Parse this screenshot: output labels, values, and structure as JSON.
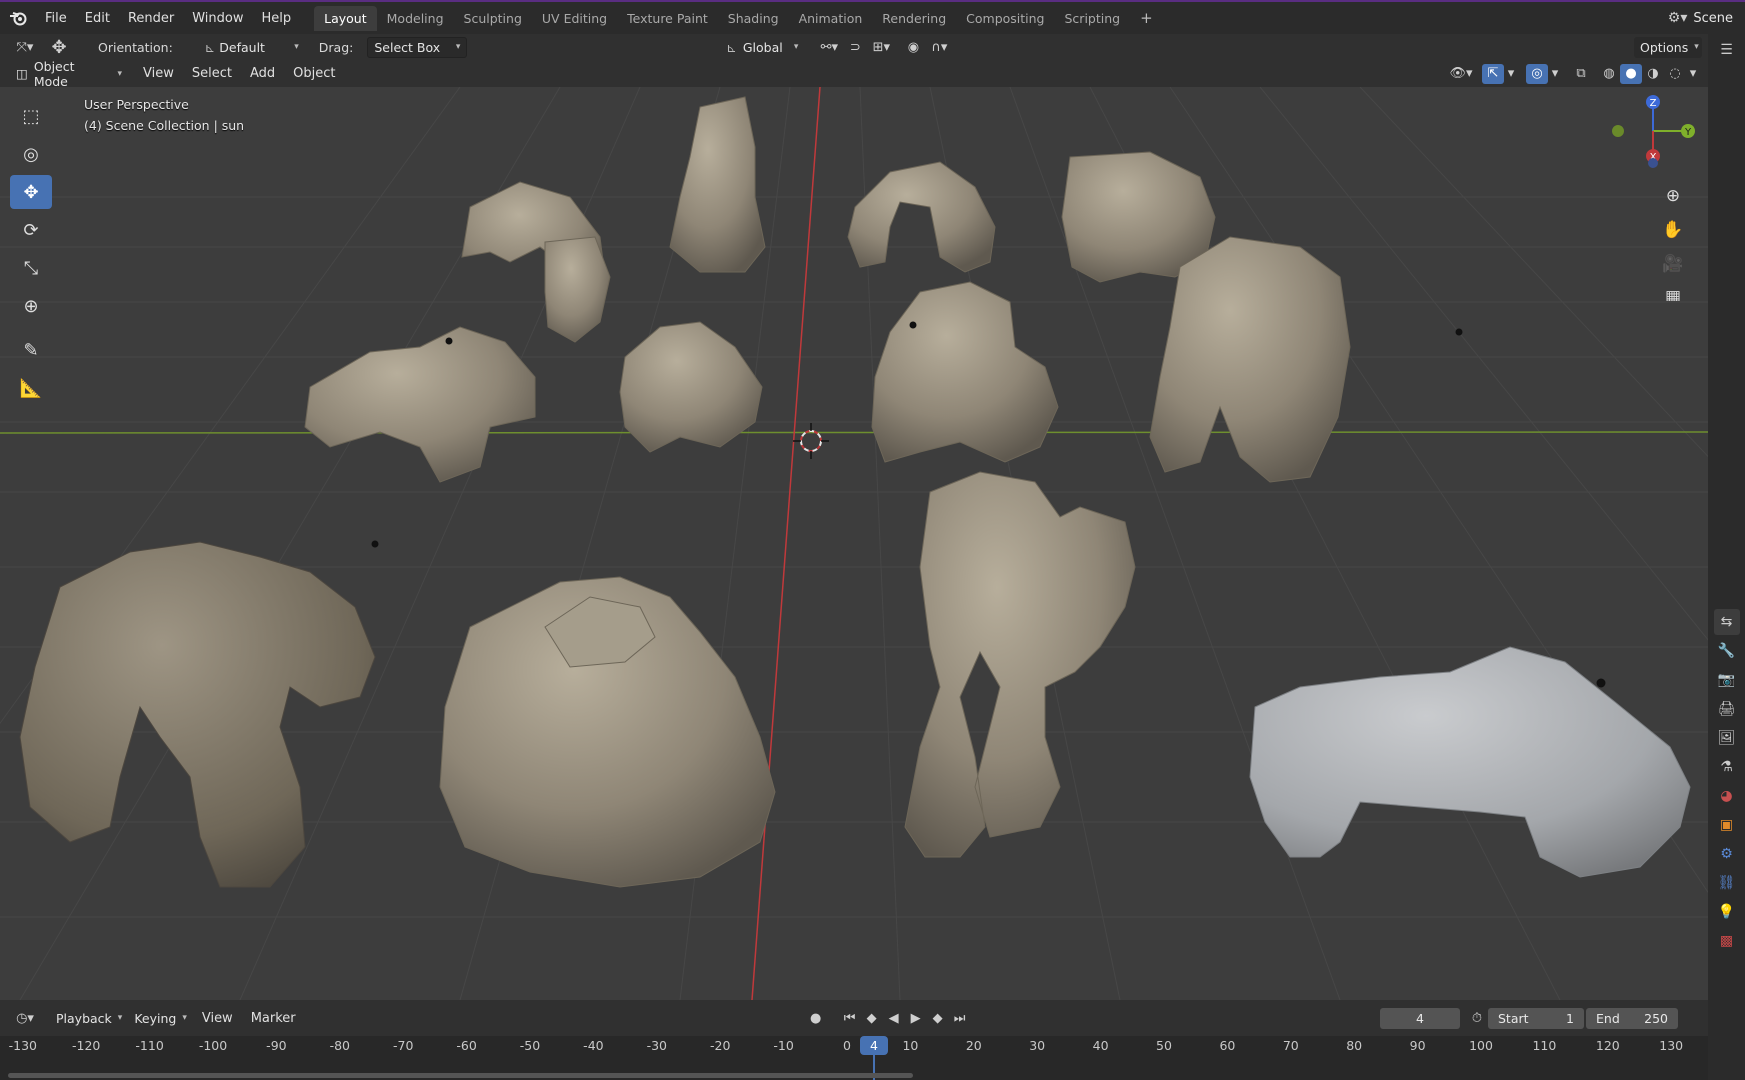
{
  "topbar": {
    "menus": [
      "File",
      "Edit",
      "Render",
      "Window",
      "Help"
    ],
    "workspaces": [
      "Layout",
      "Modeling",
      "Sculpting",
      "UV Editing",
      "Texture Paint",
      "Shading",
      "Animation",
      "Rendering",
      "Compositing",
      "Scripting"
    ],
    "active_workspace": "Layout",
    "scene_label": "Scene"
  },
  "tool_header": {
    "orientation_label": "Orientation:",
    "orientation_value": "Default",
    "drag_label": "Drag:",
    "drag_value": "Select Box",
    "transform_orientation": "Global",
    "options_label": "Options"
  },
  "view_header": {
    "mode": "Object Mode",
    "menus": [
      "View",
      "Select",
      "Add",
      "Object"
    ]
  },
  "viewport": {
    "perspective_label": "User Perspective",
    "collection_label": "(4) Scene Collection | sun",
    "gizmo_axes": [
      "Z",
      "Y",
      "X"
    ]
  },
  "timeline_header": {
    "menus": [
      "Playback",
      "Keying",
      "View",
      "Marker"
    ],
    "current_frame": "4",
    "start_label": "Start",
    "start_value": "1",
    "end_label": "End",
    "end_value": "250"
  },
  "timeline": {
    "ticks": [
      "-130",
      "-120",
      "-110",
      "-100",
      "-90",
      "-80",
      "-70",
      "-60",
      "-50",
      "-40",
      "-30",
      "-20",
      "-10",
      "0",
      "4",
      "10",
      "20",
      "30",
      "40",
      "50",
      "60",
      "70",
      "80",
      "90",
      "100",
      "110",
      "120",
      "130"
    ],
    "playhead_frame": "4"
  },
  "colors": {
    "accent": "#4772b3",
    "rock": "#8c8474",
    "rock_selected": "#9c9ea1",
    "x_axis": "#c0393b",
    "y_axis": "#6b8e23"
  }
}
